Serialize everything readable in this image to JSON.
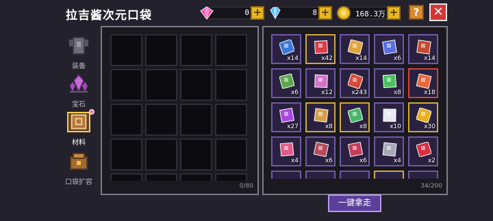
{
  "header": {
    "title": "拉吉酱次元口袋",
    "currencies": [
      {
        "icon": "pink-gem-icon",
        "value": "0"
      },
      {
        "icon": "blue-diamond-icon",
        "value": "8"
      },
      {
        "icon": "gold-coin-icon",
        "value": "168.3万"
      }
    ],
    "plus_label": "+",
    "help_label": "?",
    "close_label": "✕"
  },
  "tabs": [
    {
      "label": "装备",
      "icon": "armor-icon",
      "active": false
    },
    {
      "label": "宝石",
      "icon": "crystal-icon",
      "active": false
    },
    {
      "label": "材料",
      "icon": "materials-book-icon",
      "active": true
    },
    {
      "label": "口袋扩容",
      "icon": "pocket-expand-icon",
      "active": false
    }
  ],
  "left_panel": {
    "count": "0/80"
  },
  "right_panel": {
    "count": "34/200",
    "items": [
      {
        "icon": "snowflake-cube-icon",
        "qty": "x14",
        "color": "#3c7ad8",
        "frame": "purple"
      },
      {
        "icon": "red-feather-icon",
        "qty": "x42",
        "color": "#d8404a",
        "frame": "gold"
      },
      {
        "icon": "gold-bell-icon",
        "qty": "x14",
        "color": "#e2a53a",
        "frame": "purple"
      },
      {
        "icon": "blue-scroll-icon",
        "qty": "x6",
        "color": "#5b6fe0",
        "frame": "purple"
      },
      {
        "icon": "red-bowl-icon",
        "qty": "x14",
        "color": "#c44a30",
        "frame": "purple"
      },
      {
        "icon": "green-sprout-icon",
        "qty": "x6",
        "color": "#5aa84a",
        "frame": "purple"
      },
      {
        "icon": "pink-shell-icon",
        "qty": "x12",
        "color": "#d470c8",
        "frame": "purple"
      },
      {
        "icon": "red-tile-icon",
        "qty": "x243",
        "color": "#d84a3a",
        "frame": "purple"
      },
      {
        "icon": "green-chip-icon",
        "qty": "x8",
        "color": "#4cc060",
        "frame": "purple"
      },
      {
        "icon": "fire-pile-icon",
        "qty": "x18",
        "color": "#e8683a",
        "frame": "red"
      },
      {
        "icon": "purple-rune-icon",
        "qty": "x27",
        "color": "#a848e0",
        "frame": "purple"
      },
      {
        "icon": "gold-pickaxe-icon",
        "qty": "x8",
        "color": "#d6a04a",
        "frame": "gold"
      },
      {
        "icon": "green-serpent-icon",
        "qty": "x8",
        "color": "#48b868",
        "frame": "gold"
      },
      {
        "icon": "energy-orb-icon",
        "qty": "x10",
        "color": "#e8e8f0",
        "frame": "purple"
      },
      {
        "icon": "sun-gem-icon",
        "qty": "x30",
        "color": "#e8b020",
        "frame": "gold"
      },
      {
        "icon": "pink-crystal-icon",
        "qty": "x4",
        "color": "#e05a8a",
        "frame": "purple"
      },
      {
        "icon": "wing-blade-icon",
        "qty": "x6",
        "color": "#b84a5a",
        "frame": "purple"
      },
      {
        "icon": "horseshoe-magnet-icon",
        "qty": "x6",
        "color": "#c83a5a",
        "frame": "purple"
      },
      {
        "icon": "grey-ring-icon",
        "qty": "x4",
        "color": "#a8a8b8",
        "frame": "purple"
      },
      {
        "icon": "red-potion-icon",
        "qty": "x2",
        "color": "#d83040",
        "frame": "purple"
      },
      {
        "icon": "hidden-item-icon",
        "qty": "",
        "color": "#2a2140",
        "frame": "purple"
      },
      {
        "icon": "hidden-item-icon",
        "qty": "",
        "color": "#2a2140",
        "frame": "purple"
      },
      {
        "icon": "hidden-item-icon",
        "qty": "",
        "color": "#2a2140",
        "frame": "purple"
      },
      {
        "icon": "hidden-item-icon",
        "qty": "",
        "color": "#2a2140",
        "frame": "gold"
      },
      {
        "icon": "hidden-item-icon",
        "qty": "",
        "color": "#2a2140",
        "frame": "purple"
      }
    ]
  },
  "take_all_label": "一键拿走"
}
